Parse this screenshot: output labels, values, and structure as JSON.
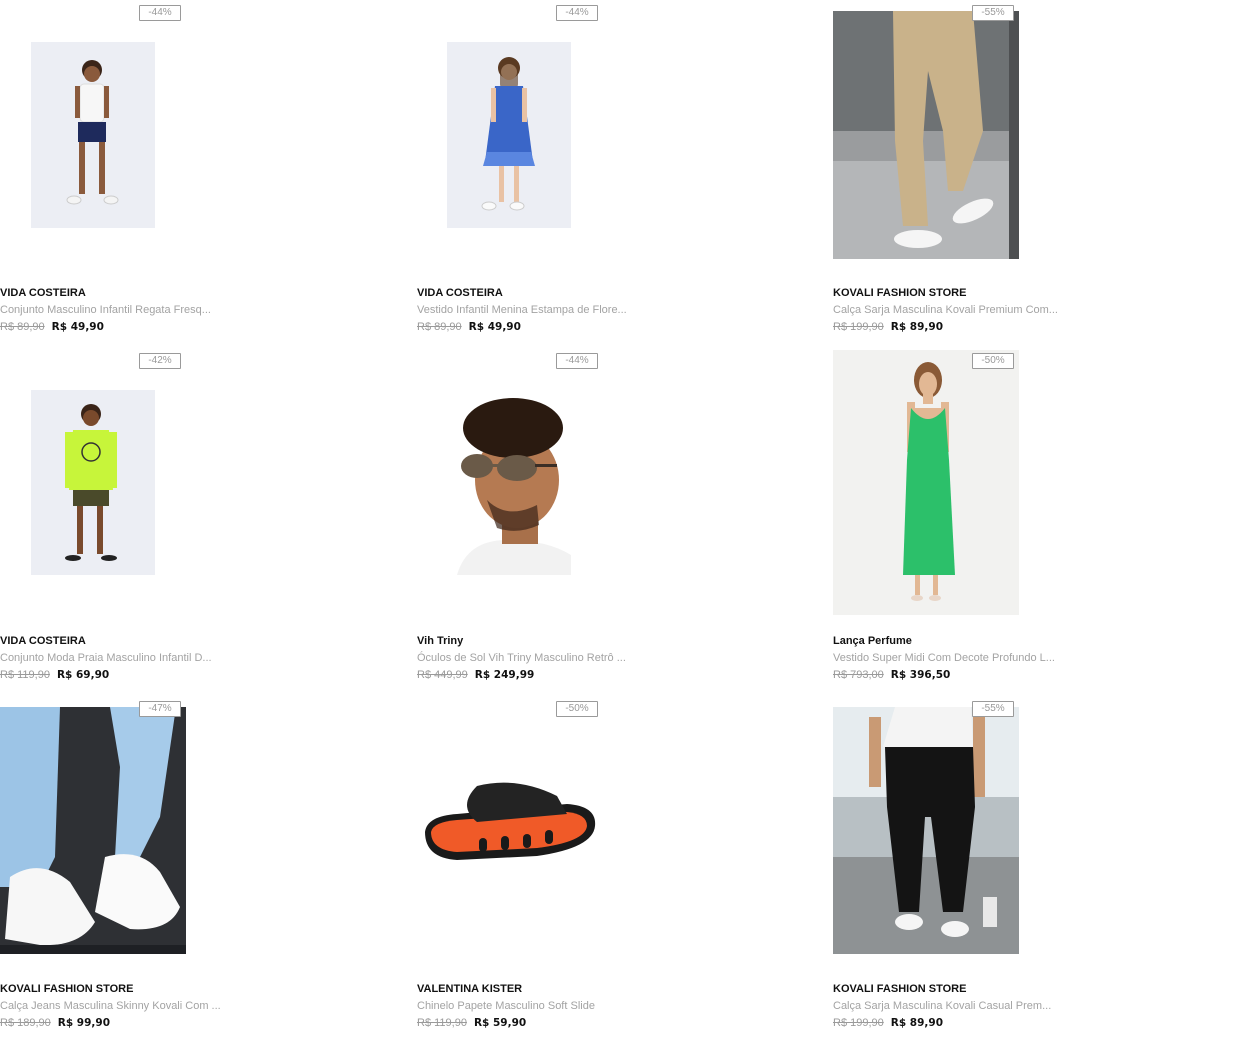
{
  "products": [
    {
      "discount": "-44%",
      "brand": "VIDA COSTEIRA",
      "name": "Conjunto Masculino Infantil Regata Fresq...",
      "old_price": "R$ 89,90",
      "price": "R$ 49,90",
      "image": "kids-boy-tanktop"
    },
    {
      "discount": "-44%",
      "brand": "VIDA COSTEIRA",
      "name": "Vestido Infantil Menina Estampa de Flore...",
      "old_price": "R$ 89,90",
      "price": "R$ 49,90",
      "image": "girl-blue-dress"
    },
    {
      "discount": "-55%",
      "brand": "KOVALI FASHION STORE",
      "name": "Calça Sarja Masculina Kovali Premium Com...",
      "old_price": "R$ 199,90",
      "price": "R$ 89,90",
      "image": "khaki-pants"
    },
    {
      "discount": "-42%",
      "brand": "VIDA COSTEIRA",
      "name": "Conjunto Moda Praia Masculino Infantil D...",
      "old_price": "R$ 119,90",
      "price": "R$ 69,90",
      "image": "kids-boy-neon-shirt"
    },
    {
      "discount": "-44%",
      "brand": "Vih Triny",
      "name": "Óculos de Sol Vih Triny Masculino Retrô ...",
      "old_price": "R$ 449,99",
      "price": "R$ 249,99",
      "image": "man-sunglasses"
    },
    {
      "discount": "-50%",
      "brand": "Lança Perfume",
      "name": "Vestido Super Midi Com Decote Profundo L...",
      "old_price": "R$ 793,00",
      "price": "R$ 396,50",
      "image": "green-dress"
    },
    {
      "discount": "-47%",
      "brand": "KOVALI FASHION STORE",
      "name": "Calça Jeans Masculina Skinny Kovali Com ...",
      "old_price": "R$ 189,90",
      "price": "R$ 99,90",
      "image": "jeans-sneakers"
    },
    {
      "discount": "-50%",
      "brand": "VALENTINA KISTER",
      "name": "Chinelo Papete Masculino Soft Slide",
      "old_price": "R$ 119,90",
      "price": "R$ 59,90",
      "image": "black-orange-slide"
    },
    {
      "discount": "-55%",
      "brand": "KOVALI FASHION STORE",
      "name": "Calça Sarja Masculina Kovali Casual Prem...",
      "old_price": "R$ 199,90",
      "price": "R$ 89,90",
      "image": "black-pants"
    }
  ]
}
